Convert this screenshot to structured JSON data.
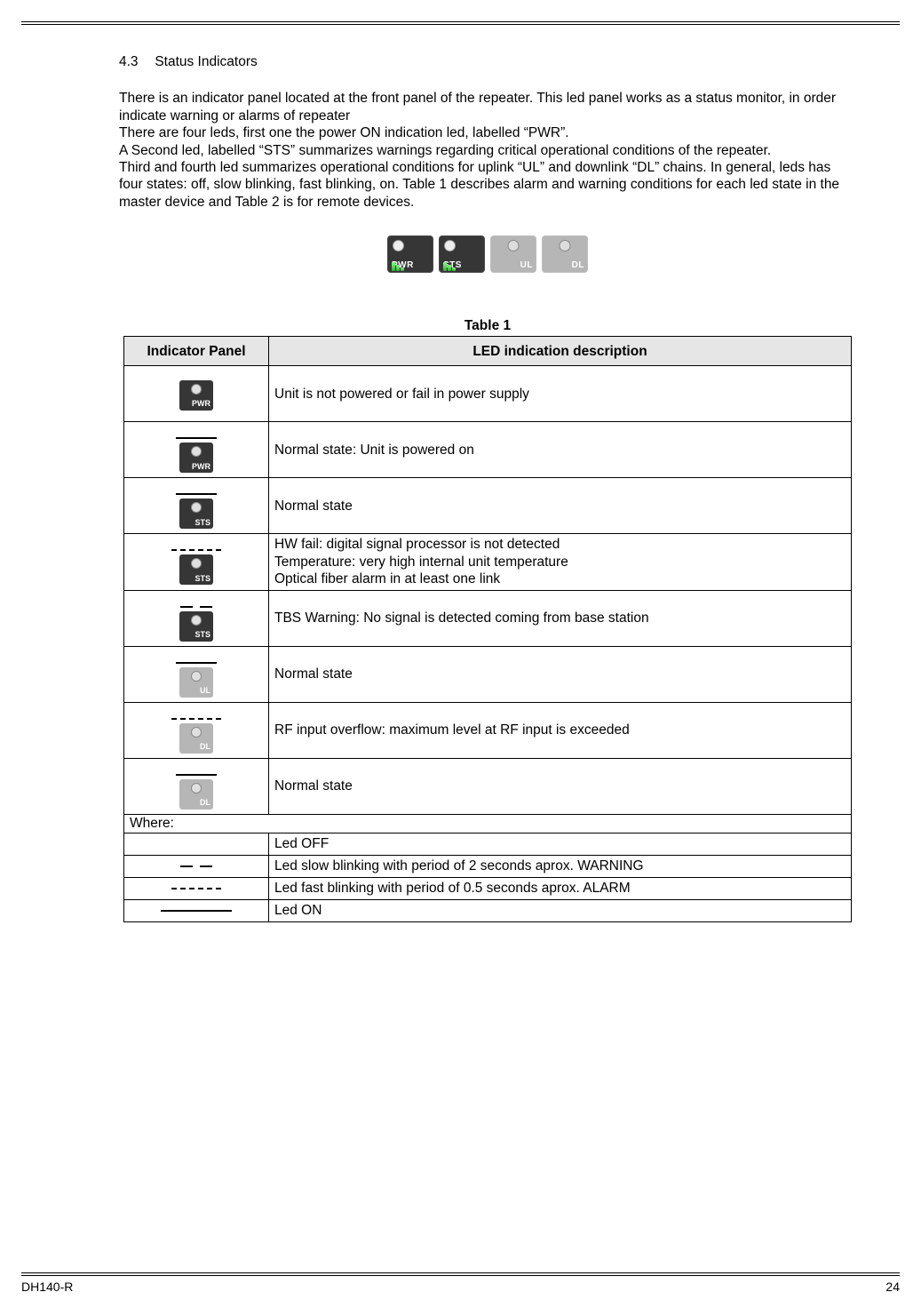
{
  "section": {
    "number": "4.3",
    "title": "Status Indicators"
  },
  "paragraphs": {
    "p1": "There is an indicator panel located at the front panel of the repeater. This led panel works as a status monitor, in order indicate warning or alarms of repeater",
    "p2": "There are four leds, first one the power ON indication led, labelled “PWR”.",
    "p3": "A Second led, labelled “STS” summarizes warnings regarding critical operational conditions of the repeater.",
    "p4": "Third and fourth led summarizes operational conditions for uplink “UL” and downlink “DL” chains. In general, leds has four states: off, slow blinking, fast blinking, on. Table 1 describes alarm and warning conditions for each led state in the master device and Table 2 is for remote devices."
  },
  "panel": {
    "labels": [
      "PWR",
      "STS",
      "UL",
      "DL"
    ]
  },
  "table": {
    "caption": "Table 1",
    "head": {
      "col1": "Indicator Panel",
      "col2": "LED indication description"
    },
    "rows": [
      {
        "label": "PWR",
        "tone": "dark",
        "state": "none",
        "desc": "Unit is not powered or fail in power supply"
      },
      {
        "label": "PWR",
        "tone": "dark",
        "state": "on",
        "desc": "Normal state: Unit is powered on"
      },
      {
        "label": "STS",
        "tone": "dark",
        "state": "on",
        "desc": "Normal state"
      },
      {
        "label": "STS",
        "tone": "dark",
        "state": "fast",
        "desc": "HW fail: digital signal processor is not detected\nTemperature: very high internal unit temperature\nOptical fiber alarm in at least one link"
      },
      {
        "label": "STS",
        "tone": "dark",
        "state": "slow",
        "desc": "TBS Warning: No signal is detected coming from base station"
      },
      {
        "label": "UL",
        "tone": "light",
        "state": "on",
        "desc": "Normal state"
      },
      {
        "label": "DL",
        "tone": "light",
        "state": "fast",
        "desc": "RF input overflow: maximum level at RF input is exceeded"
      },
      {
        "label": "DL",
        "tone": "light",
        "state": "on",
        "desc": "Normal state"
      }
    ],
    "where": "Where:",
    "legend": [
      {
        "state": "none",
        "desc": "Led OFF"
      },
      {
        "state": "slow",
        "desc": "Led slow blinking with period of 2 seconds aprox. WARNING"
      },
      {
        "state": "fast",
        "desc": "Led fast blinking with period of 0.5 seconds aprox. ALARM"
      },
      {
        "state": "on",
        "desc": "Led ON"
      }
    ]
  },
  "footer": {
    "left": "DH140-R",
    "right": "24"
  }
}
